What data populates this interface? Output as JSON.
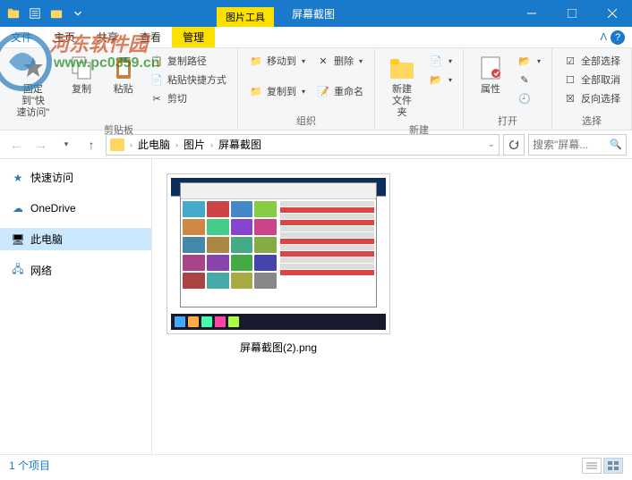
{
  "watermark": {
    "text1": "河东软件园",
    "text2": "www.pc0359.cn"
  },
  "titlebar": {
    "context_tab": "图片工具",
    "title": "屏幕截图"
  },
  "menubar": {
    "file": "文件",
    "home": "主页",
    "share": "共享",
    "view": "查看",
    "manage": "管理"
  },
  "ribbon": {
    "pin_label": "固定到\"快\n速访问\"",
    "copy_label": "复制",
    "paste_label": "粘贴",
    "copy_path": "复制路径",
    "paste_shortcut": "粘贴快捷方式",
    "cut": "剪切",
    "clipboard_group": "剪贴板",
    "move_to": "移动到",
    "copy_to": "复制到",
    "delete": "删除",
    "rename": "重命名",
    "organize_group": "组织",
    "new_folder": "新建\n文件夹",
    "new_group": "新建",
    "properties": "属性",
    "open_group": "打开",
    "select_all": "全部选择",
    "select_none": "全部取消",
    "invert_selection": "反向选择",
    "select_group": "选择"
  },
  "breadcrumb": {
    "items": [
      "此电脑",
      "图片",
      "屏幕截图"
    ]
  },
  "search": {
    "placeholder": "搜索\"屏幕..."
  },
  "sidebar": {
    "quick_access": "快速访问",
    "onedrive": "OneDrive",
    "this_pc": "此电脑",
    "network": "网络"
  },
  "file": {
    "name": "屏幕截图(2).png"
  },
  "statusbar": {
    "item_count": "1 个项目"
  }
}
